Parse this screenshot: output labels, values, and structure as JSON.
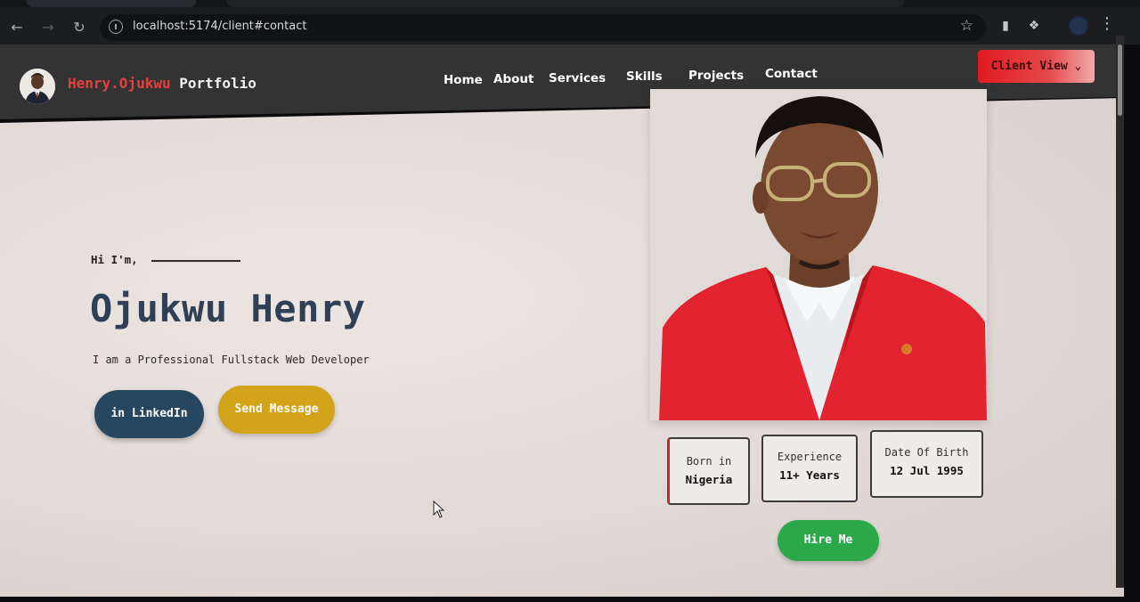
{
  "browser": {
    "url": "localhost:5174/client#contact",
    "icons": [
      "back-icon",
      "forward-icon",
      "reload-icon",
      "site-info-icon",
      "bookmark-star-icon",
      "extension-icon",
      "puzzle-icon",
      "profile-icon",
      "menu-icon"
    ]
  },
  "header": {
    "brand_first": "Henry.Ojukwu",
    "brand_rest": " Portfolio",
    "nav": [
      "Home",
      "About",
      "Services",
      "Skills",
      "Projects",
      "Contact"
    ],
    "client_button": "Client View",
    "colors": {
      "brand": "#e2423b",
      "header_bg": "#333334",
      "client_button": "#e01a1f"
    }
  },
  "hero": {
    "greeting": "Hi I'm,",
    "name": "Ojukwu Henry",
    "tagline": "I am a Professional Fullstack Web Developer",
    "linkedin_icon_text": "in",
    "linkedin_label": "LinkedIn",
    "message_label": "Send Message",
    "hire_label": "Hire Me",
    "colors": {
      "name": "#2e3f56",
      "linkedin": "#26475f",
      "message": "#d3a41a",
      "hire": "#2aa84a"
    }
  },
  "cards": [
    {
      "label": "Born in",
      "value": "Nigeria"
    },
    {
      "label": "Experience",
      "value": "11+ Years"
    },
    {
      "label": "Date Of Birth",
      "value": "12 Jul 1995"
    }
  ]
}
